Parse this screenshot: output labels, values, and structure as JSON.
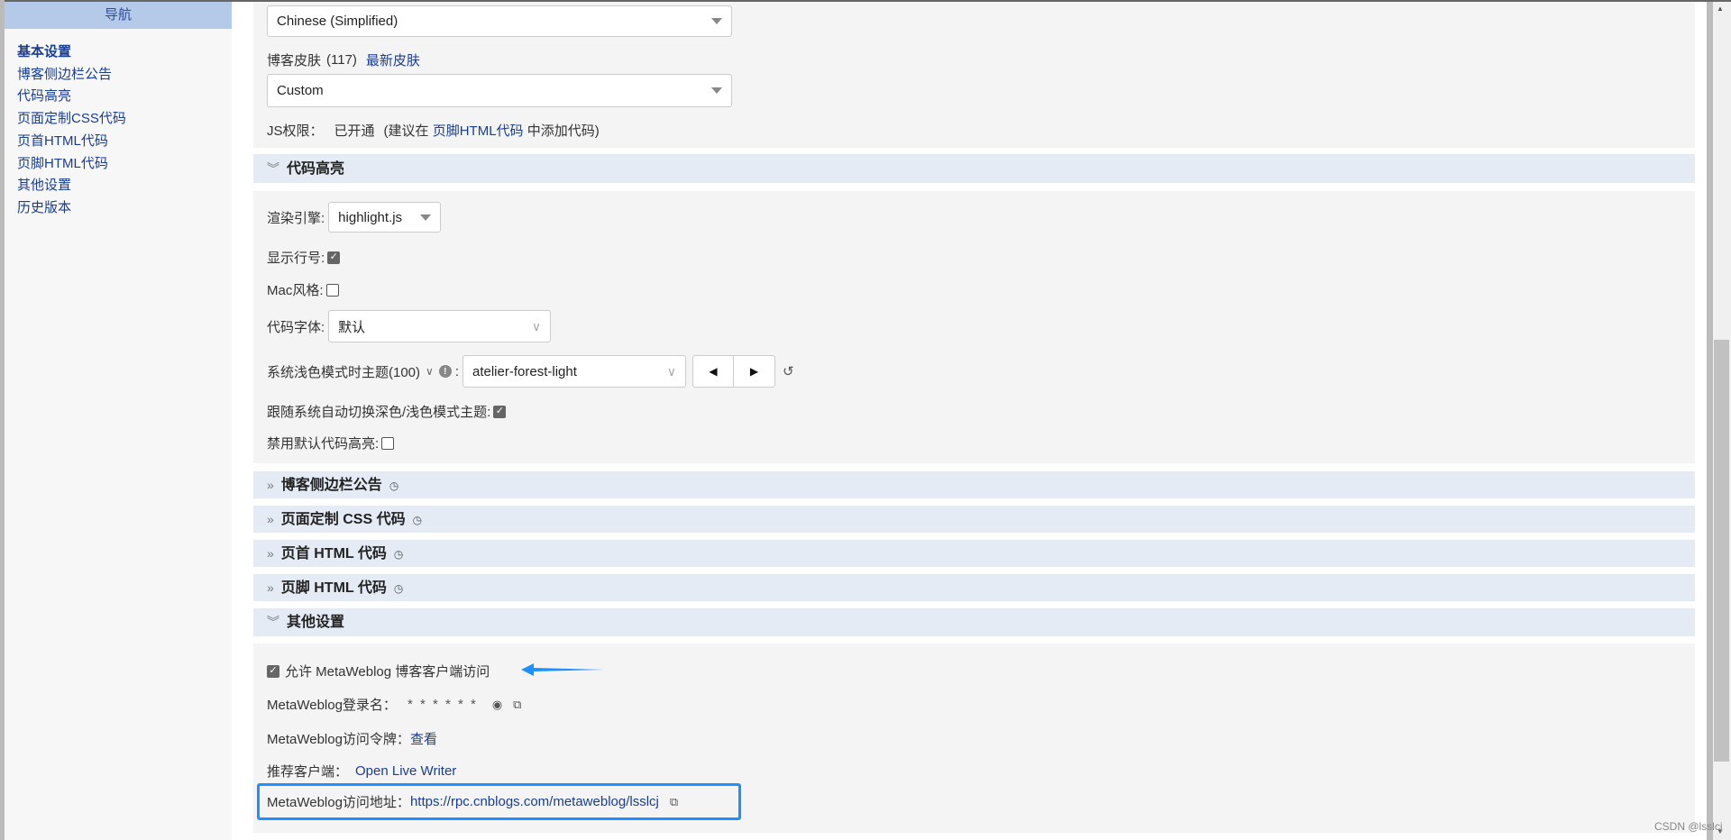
{
  "nav": {
    "title": "导航",
    "items": [
      {
        "label": "基本设置",
        "active": true
      },
      {
        "label": "博客侧边栏公告"
      },
      {
        "label": "代码高亮"
      },
      {
        "label": "页面定制CSS代码"
      },
      {
        "label": "页首HTML代码"
      },
      {
        "label": "页脚HTML代码"
      },
      {
        "label": "其他设置"
      },
      {
        "label": "历史版本"
      }
    ]
  },
  "basic": {
    "language": "Chinese (Simplified)",
    "skin_label": "博客皮肤",
    "skin_count": "(117)",
    "skin_link": "最新皮肤",
    "skin_value": "Custom",
    "js_label": "JS权限：",
    "js_status": "已开通",
    "js_hint_pre": "(建议在",
    "js_hint_link": "页脚HTML代码",
    "js_hint_post": "中添加代码)"
  },
  "highlight": {
    "title": "代码高亮",
    "engine_label": "渲染引擎:",
    "engine_value": "highlight.js",
    "line_numbers_label": "显示行号:",
    "line_numbers": true,
    "mac_label": "Mac风格:",
    "mac": false,
    "font_label": "代码字体:",
    "font_value": "默认",
    "theme_label": "系统浅色模式时主题(100)",
    "theme_value": "atelier-forest-light",
    "auto_label": "跟随系统自动切换深色/浅色模式主题:",
    "auto": true,
    "disable_label": "禁用默认代码高亮:",
    "disable": false
  },
  "sections": [
    {
      "title": "博客侧边栏公告"
    },
    {
      "title": "页面定制 CSS 代码"
    },
    {
      "title": "页首 HTML 代码"
    },
    {
      "title": "页脚 HTML 代码"
    }
  ],
  "other": {
    "title": "其他设置",
    "allow_label": "允许 MetaWeblog 博客客户端访问",
    "allow": true,
    "login_label": "MetaWeblog登录名：",
    "login_value": "* * * * * *",
    "token_label": "MetaWeblog访问令牌：",
    "token_link": "查看",
    "client_label": "推荐客户端：",
    "client_link": "Open Live Writer",
    "address_label": "MetaWeblog访问地址：",
    "address_value": "https://rpc.cnblogs.com/metaweblog/lsslcj"
  },
  "watermark": "CSDN @lsslcj",
  "colors": {
    "accent": "#1e90ff",
    "link": "#1a3d8f",
    "section_header": "#e4ebf5",
    "nav_header": "#b5c9e8"
  }
}
